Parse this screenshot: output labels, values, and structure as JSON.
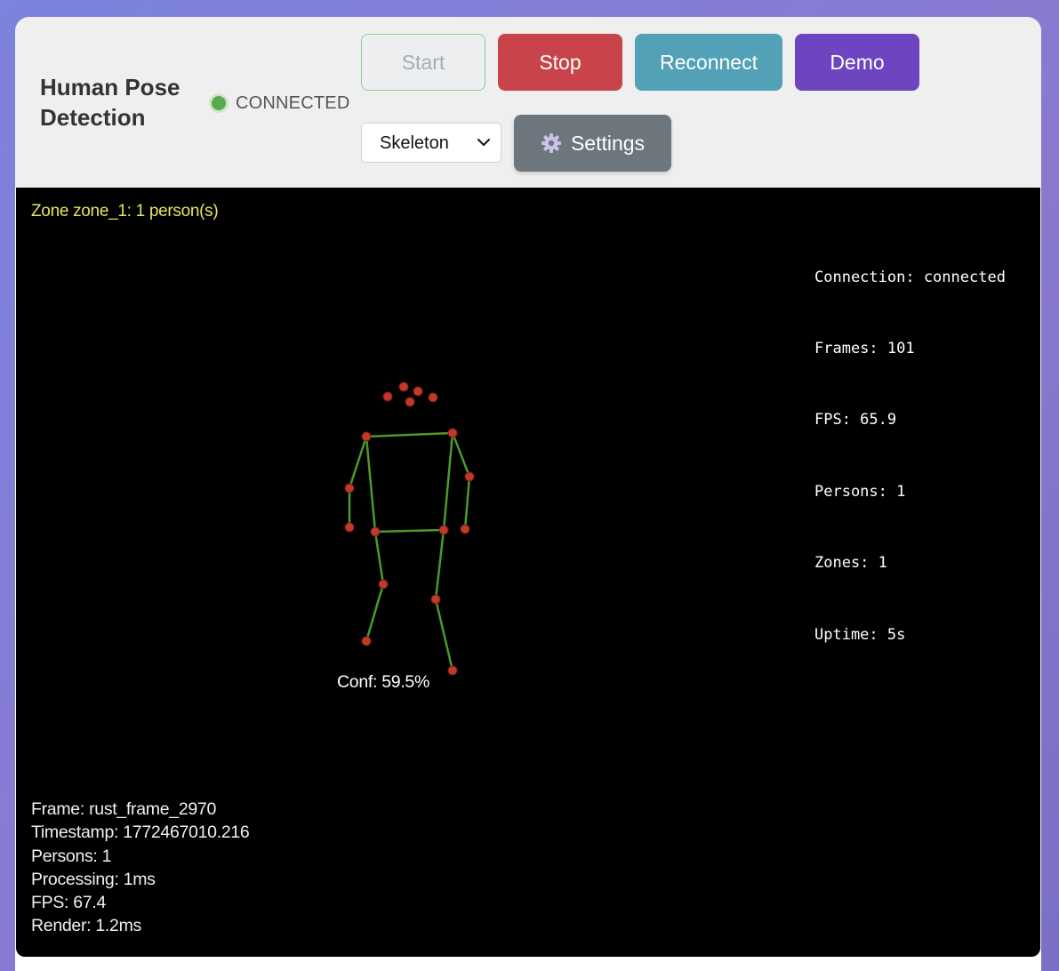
{
  "header": {
    "title": "Human Pose Detection",
    "status": {
      "text": "CONNECTED",
      "color": "#5aa84f"
    },
    "buttons": {
      "start": "Start",
      "stop": "Stop",
      "reconnect": "Reconnect",
      "demo": "Demo",
      "settings": "Settings"
    },
    "mode_select": {
      "value": "Skeleton"
    }
  },
  "canvas": {
    "zone_label": "Zone zone_1: 1 person(s)",
    "stats": [
      "Connection: connected",
      "Frames: 101",
      "FPS: 65.9",
      "Persons: 1",
      "Zones: 1",
      "Uptime: 5s"
    ],
    "frame_info": [
      "Frame: rust_frame_2970",
      "Timestamp: 1772467010.216",
      "Persons: 1",
      "Processing: 1ms",
      "FPS: 67.4",
      "Render: 1.2ms"
    ],
    "confidence_label": "Conf: 59.5%",
    "colors": {
      "keypoint": "#c0392b",
      "skeleton": "#4c9a2a",
      "zone_text": "#e6e65a"
    }
  }
}
